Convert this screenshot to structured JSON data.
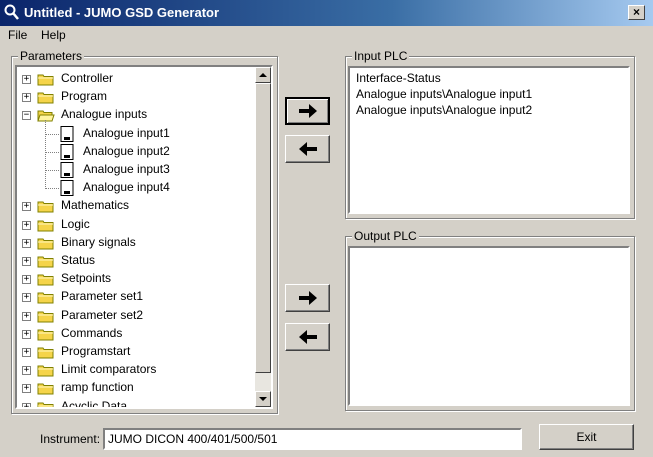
{
  "window": {
    "title": "Untitled - JUMO GSD Generator",
    "close_label": "×"
  },
  "menu": [
    "File",
    "Help"
  ],
  "parameters": {
    "label": "Parameters",
    "tree": [
      {
        "label": "Controller",
        "type": "folder",
        "expander": "+"
      },
      {
        "label": "Program",
        "type": "folder",
        "expander": "+"
      },
      {
        "label": "Analogue inputs",
        "type": "folder-open",
        "expander": "−"
      },
      {
        "label": "Analogue input1",
        "type": "doc"
      },
      {
        "label": "Analogue input2",
        "type": "doc"
      },
      {
        "label": "Analogue input3",
        "type": "doc"
      },
      {
        "label": "Analogue input4",
        "type": "doc"
      },
      {
        "label": "Mathematics",
        "type": "folder",
        "expander": "+"
      },
      {
        "label": "Logic",
        "type": "folder",
        "expander": "+"
      },
      {
        "label": "Binary signals",
        "type": "folder",
        "expander": "+"
      },
      {
        "label": "Status",
        "type": "folder",
        "expander": "+"
      },
      {
        "label": "Setpoints",
        "type": "folder",
        "expander": "+"
      },
      {
        "label": "Parameter set1",
        "type": "folder",
        "expander": "+"
      },
      {
        "label": "Parameter set2",
        "type": "folder",
        "expander": "+"
      },
      {
        "label": "Commands",
        "type": "folder",
        "expander": "+"
      },
      {
        "label": "Programstart",
        "type": "folder",
        "expander": "+"
      },
      {
        "label": "Limit comparators",
        "type": "folder",
        "expander": "+"
      },
      {
        "label": "ramp function",
        "type": "folder",
        "expander": "+"
      },
      {
        "label": "Acyclic Data",
        "type": "folder",
        "expander": "+"
      }
    ]
  },
  "input_plc": {
    "label": "Input PLC",
    "items": [
      "Interface-Status",
      "Analogue inputs\\Analogue input1",
      "Analogue inputs\\Analogue input2"
    ]
  },
  "output_plc": {
    "label": "Output PLC",
    "items": []
  },
  "arrows": {
    "right": "➜",
    "left": "⬅"
  },
  "instrument": {
    "label": "Instrument:",
    "value": "JUMO DICON 400/401/500/501"
  },
  "exit_label": "Exit",
  "colors": {
    "titlebar_start": "#0a246a",
    "titlebar_end": "#a6caf0",
    "face": "#d4d0c8",
    "folder": "#f5d44a"
  }
}
